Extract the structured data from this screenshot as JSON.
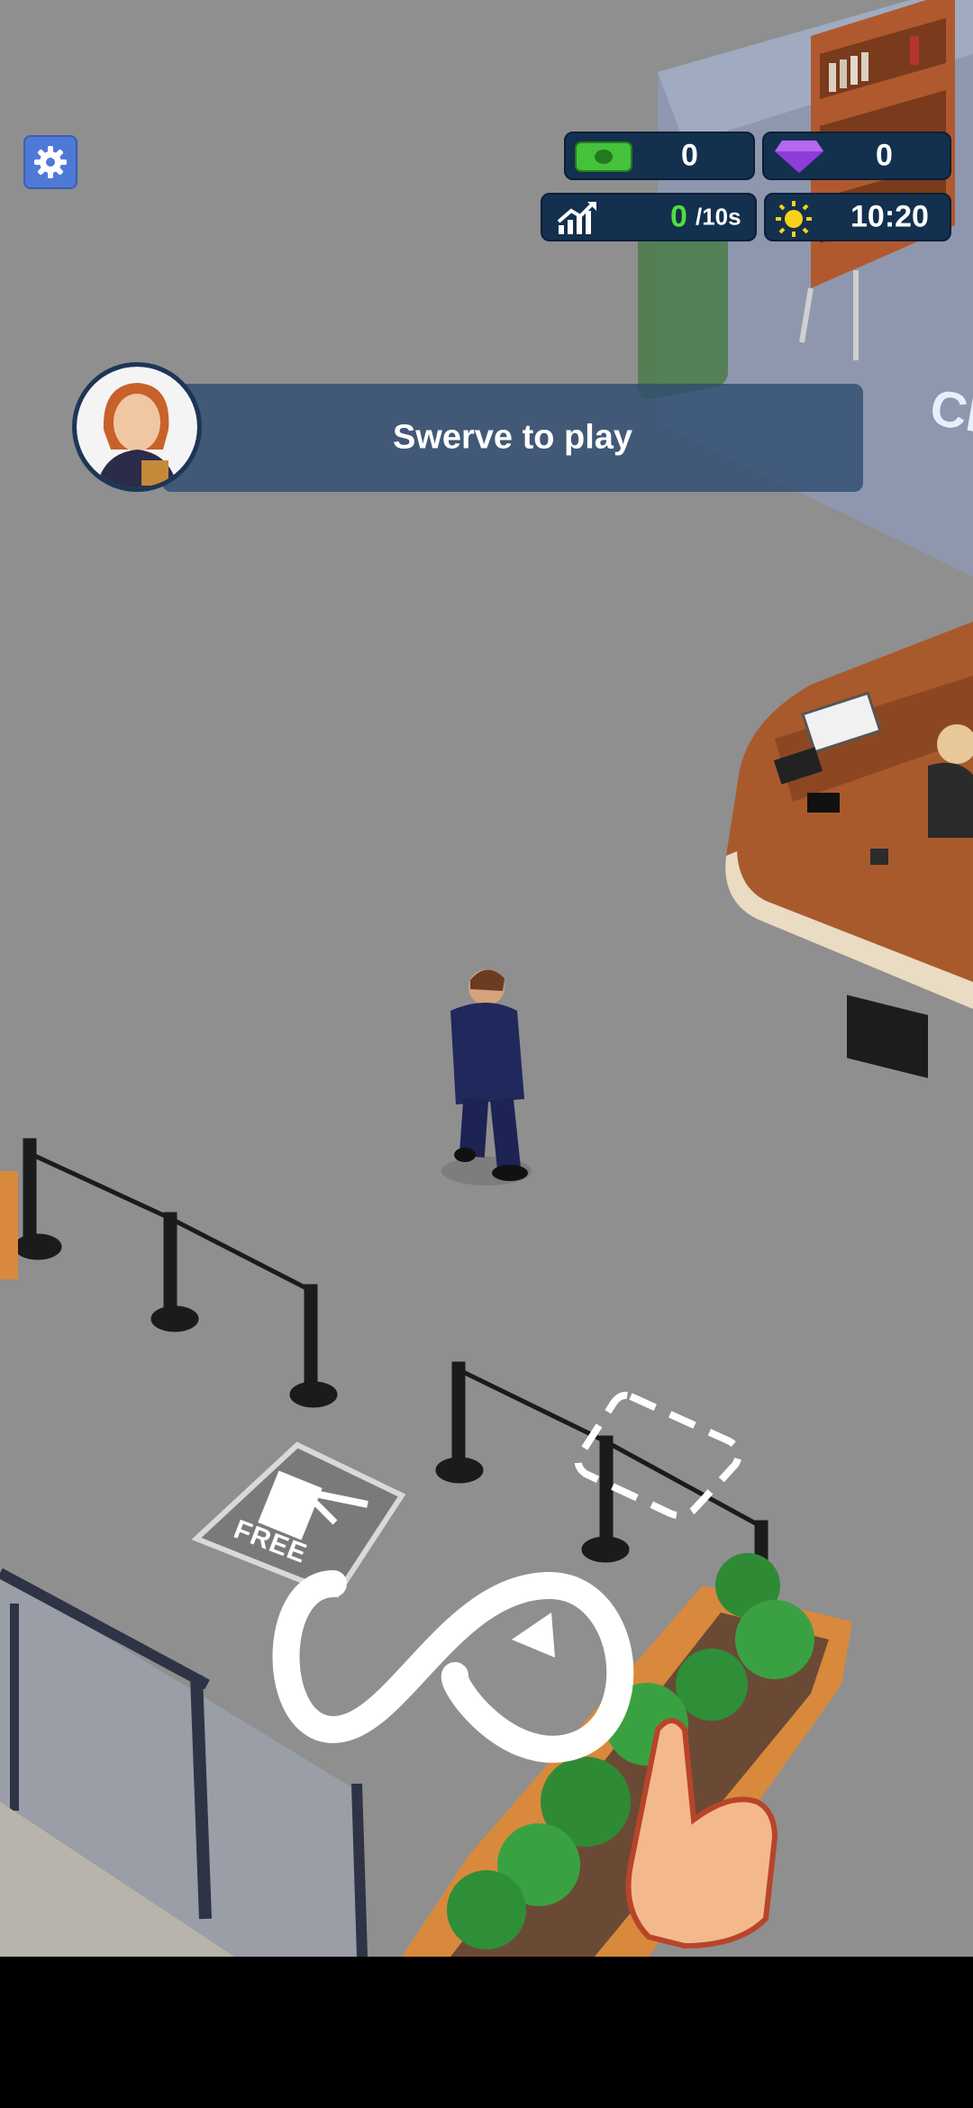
{
  "hud": {
    "cash": "0",
    "gems": "0",
    "income_value": "0",
    "income_period": "/10s",
    "clock": "10:20",
    "colors": {
      "panel": "#14304f",
      "cash_green": "#44c23a",
      "gem_purple": "#8f3bd9",
      "income_green": "#4fe03b",
      "sun_yellow": "#f6d21d"
    }
  },
  "icons": {
    "settings": "gear-icon",
    "cash": "cash-icon",
    "gems": "gem-icon",
    "income": "chart-up-icon",
    "clock": "sun-icon"
  },
  "tutorial": {
    "message": "Swerve to play",
    "gesture": "infinity-swipe"
  },
  "floor": {
    "purchase_label": "FREE"
  }
}
